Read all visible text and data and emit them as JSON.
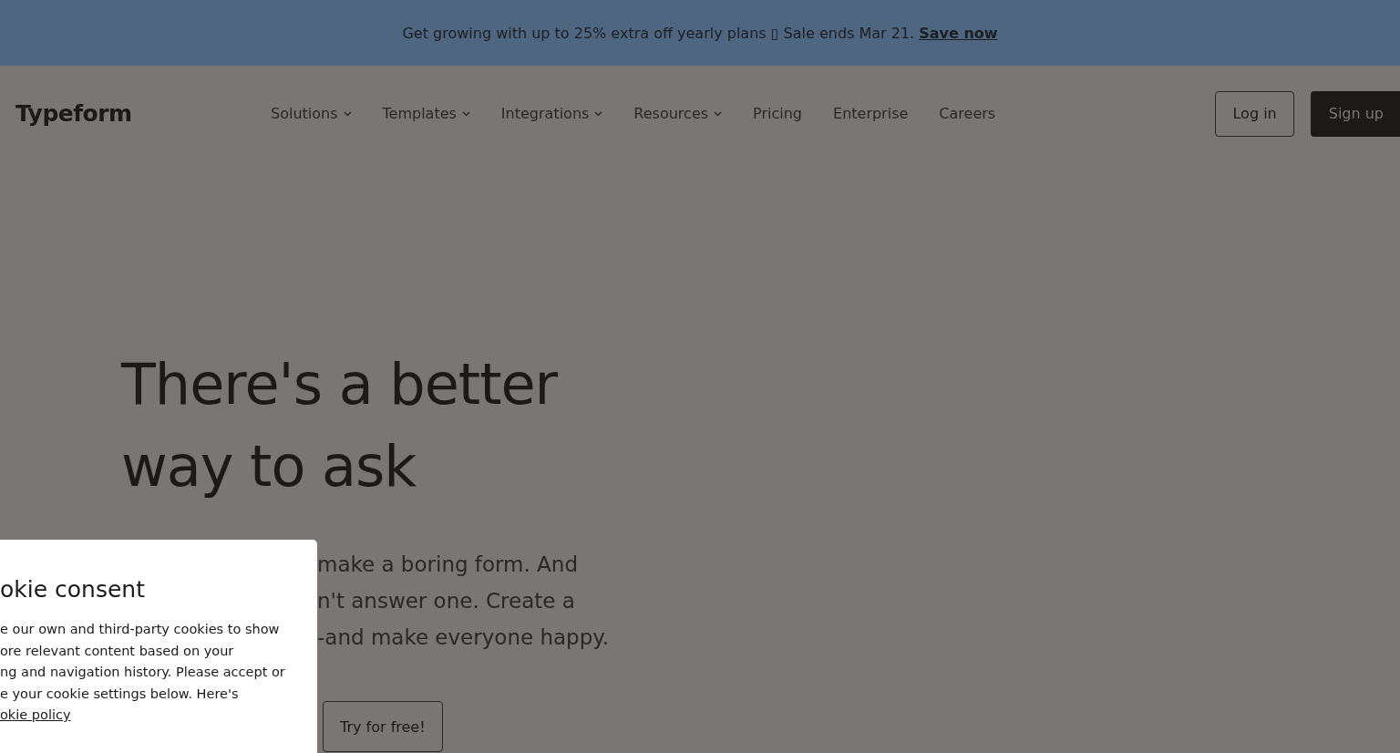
{
  "banner": {
    "text": "Get growing with up to 25% extra off yearly plans ▯ Sale ends Mar 21.",
    "link": "Save now"
  },
  "nav": {
    "logo": "Typeform",
    "items": [
      {
        "label": "Solutions",
        "dropdown": true
      },
      {
        "label": "Templates",
        "dropdown": true
      },
      {
        "label": "Integrations",
        "dropdown": true
      },
      {
        "label": "Resources",
        "dropdown": true
      },
      {
        "label": "Pricing",
        "dropdown": false
      },
      {
        "label": "Enterprise",
        "dropdown": false
      },
      {
        "label": "Careers",
        "dropdown": false
      }
    ],
    "login": "Log in",
    "signup": "Sign up"
  },
  "hero": {
    "headline_lines": [
      "There's a better",
      "way to ask"
    ],
    "body_lines": [
      "make a boring form. And",
      "n't answer one. Create a",
      "-and make everyone happy."
    ],
    "cta": "Try for free!"
  },
  "cookie_panel": {
    "title": "okie consent",
    "body_lines": [
      "e our own and third-party cookies to show",
      "ore relevant content based on your",
      "ng and navigation history. Please accept or",
      "e your cookie settings below. Here's"
    ],
    "link": "okie policy"
  }
}
